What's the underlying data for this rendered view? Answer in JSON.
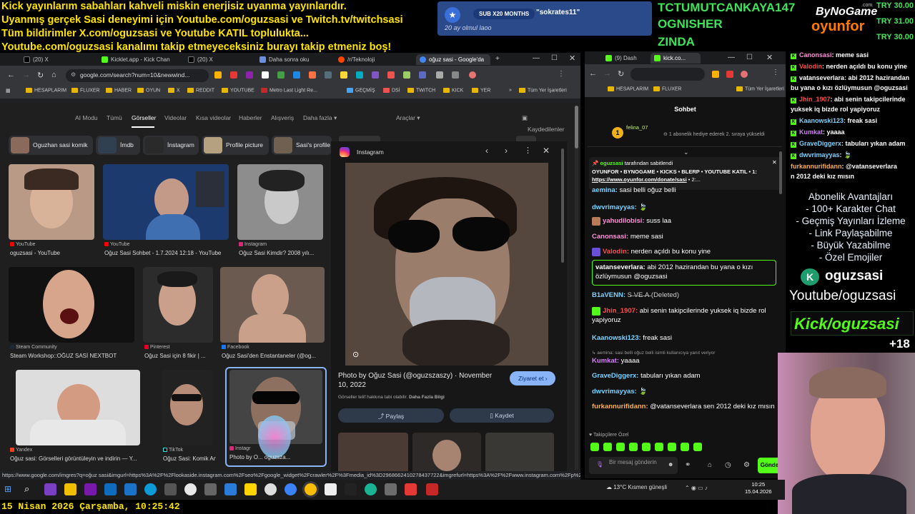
{
  "overlay": {
    "lines": [
      "Kick yayınlarım sabahları kahveli miskin enerjisiz uyanma yayınlarıdır.",
      "Uyanmış gerçek Sasi deneyimi için Youtube.com/oguzsasi ve Twitch.tv/twitchsasi",
      "Tüm bildirimler X.com/oguzsasi ve Youtube KATIL toplulukta...",
      "Youtube.com/oguzsasi kanalımı takip etmeyeceksiniz burayı takip etmeniz boş!"
    ],
    "sub_alert": {
      "pill": "SUB X20 MONTHS",
      "name": "\"sokrates11\"",
      "ago": "20 ay olmul laoo"
    },
    "goal_names": [
      "TCTUMUTCANKAYA147",
      "OGNISHER",
      "ZINDA"
    ],
    "brand_top": "ByNoGame",
    "brand_com": ".com",
    "brand_bottom": "oyunfor",
    "donations": [
      "TRY 30.00",
      "TRY 31.00",
      "TRY 30.00"
    ],
    "date_text": "15 Nisan 2026 Çarşamba, 10:25:42"
  },
  "browser_left": {
    "tabs": [
      "(20) X",
      "Kicklet.app - Kick Chan",
      "(20) X",
      "Daha sonra oku",
      "/r/Teknoloji",
      "oğuz sasi - Google'da"
    ],
    "url": "google.com/search?num=10&newwind...",
    "bookmarks": [
      "HESAPLARIM",
      "FLUXER",
      "HABER",
      "OYUN",
      "X",
      "REDDIT",
      "YOUTUBE",
      "Metro Last Light Re...",
      "GEÇMİŞ",
      "DSİ",
      "TWITCH",
      "KICK",
      "YER",
      "Tüm Yer İşaretleri"
    ],
    "search_tabs": [
      "AI Modu",
      "Tümü",
      "Görseller",
      "Videolar",
      "Kısa videolar",
      "Haberler",
      "Alışveriş",
      "Daha fazla ▾",
      "Araçlar ▾",
      "Kaydedilenler"
    ],
    "chips": [
      "Oguzhan sasi komik",
      "İmdb",
      "İnstagram",
      "Profile picture",
      "Sasi's profile"
    ],
    "results": [
      {
        "source": "YouTube",
        "caption": "oguzsasi - YouTube"
      },
      {
        "source": "YouTube",
        "caption": "Oğuz Sasi Sohbet - 1.7.2024 12:18 - YouTube"
      },
      {
        "source": "Instagram",
        "caption": "Oğuz Sasi Kimdir? 2008 yılı..."
      },
      {
        "source": "Steam Community",
        "caption": "Steam Workshop::OĞUZ SASİ NEXTBOT"
      },
      {
        "source": "Pinterest",
        "caption": "Oğuz Sasi için 8 fikir | ..."
      },
      {
        "source": "Facebook",
        "caption": "Oğuz Sasi'den Enstantaneler (@og..."
      },
      {
        "source": "Yandex",
        "caption": "Oğuz sasi: Görselleri görüntüleyin ve indirin — Y..."
      },
      {
        "source": "TikTok",
        "caption": "Oğuz Sasi: Komik An..."
      },
      {
        "source": "Instagr",
        "caption": "Photo by O... oguzsza..."
      }
    ],
    "panel": {
      "site": "Instagram",
      "title": "Photo by Oğuz Sasi (@oguzszaszy) · November 10, 2022",
      "note": "Görseller telif hakkına tabi olabilir.",
      "note_link": "Daha Fazla Bilgi",
      "visit": "Ziyaret et",
      "share": "Paylaş",
      "save": "Kaydet"
    },
    "status_url": "https://www.google.com/imgres?q=oğuz sasi&imgurl=https%3A%2F%2Flookaside.instagram.com%2Fseo%2Fgoogle_widget%2Fcrawler%2F%3Fmedia_id%3D2968662410278437722&imgrefurl=https%3A%2F%2Fwww.instagram.com%2Fp%2FCkyzrvGs4Na%..."
  },
  "browser_right": {
    "tabs": [
      "(9) Dash",
      "kick.co..."
    ],
    "bookmarks": [
      "HESAPLARIM",
      "FLUXER",
      "Tüm Yer İşaretleri"
    ],
    "chat_title": "Sohbet",
    "gifter": {
      "rank": "1",
      "name": "felina_07",
      "text": "1 abonelik hediye ederek 2. sıraya yükseldi"
    },
    "pinned_by": "oguzsasi",
    "pinned_label": "tarafından sabitlendi",
    "pinned_text": "OYUNFOR • BYNOGAME • KICKS • BLERP • YOUTUBE KATIL • 1:",
    "pinned_link": "https://www.oyunfor.com/donate/sasi",
    "pinned_tail": "• 2:...",
    "messages": [
      {
        "user": "aemina:",
        "text": "sasi belli oğuz belli",
        "color": "#7bd3ff"
      },
      {
        "user": "dwvrimayyas:",
        "text": "",
        "color": "#7bd3ff"
      },
      {
        "user": "yahudilobisi:",
        "text": "suss laa",
        "color": "#ff8fd8"
      },
      {
        "user": "Canonsasi:",
        "text": "meme sasi",
        "color": "#ff8fd8"
      },
      {
        "user": "Valodin:",
        "text": "nerden açıldı bu konu yine",
        "color": "#ff4d4d"
      },
      {
        "user": "vatanseverlara:",
        "text": "abi 2012 hazirandan bu yana o kızı özlüymusun @oguzsasi",
        "color": "#ffffff"
      },
      {
        "user": "B1aVENN:",
        "text": "S̶ ̶V̶E̶ ̶A̶ (Deleted)",
        "color": "#7bd3ff"
      },
      {
        "user": "Jhin_1907:",
        "text": "abi senin takipcilerinde yuksek iq bizde rol yapiyoruz",
        "color": "#ff4d4d"
      },
      {
        "user": "Kaanowski123:",
        "text": "freak sasi",
        "color": "#7bd3ff"
      },
      {
        "user": "aemina: sasi belli oğuz belli isimli kullanıcıya yanıt veriyor",
        "text": "",
        "color": "#9a9a9a"
      },
      {
        "user": "Kumkat:",
        "text": "yaaaa",
        "color": "#d67cff"
      },
      {
        "user": "GraveDiggerx:",
        "text": "tabuları yıkan adam",
        "color": "#7bd3ff"
      },
      {
        "user": "dwvrimayyas:",
        "text": "",
        "color": "#7bd3ff"
      },
      {
        "user": "furkannurifidann:",
        "text": "@vatanseverlara sen 2012 deki kız mısın",
        "color": "#ffb04d"
      }
    ],
    "follower_label": "Takipçilere Özel",
    "input_placeholder": "Bir mesaj gönderin",
    "send": "Gönder",
    "weather": "13°C  Kısmen güneşli",
    "clock": "10:25",
    "date": "15.04.2026"
  },
  "right_log": [
    {
      "user": "Canonsasi",
      "text": ": meme sasi",
      "color": "#ff8fd8"
    },
    {
      "user": "Valodin",
      "text": ": nerden açıldı bu konu yine",
      "color": "#ff4d4d"
    },
    {
      "user": "vatanseverlara",
      "text": ": abi 2012 hazirandan",
      "color": "#ffffff"
    },
    {
      "user": "",
      "text": "bu yana o kızı özlüymusun @oguzsasi",
      "color": "#ffffff"
    },
    {
      "user": "Jhin_1907",
      "text": ": abi senin takipcilerinde",
      "color": "#ff4d4d"
    },
    {
      "user": "",
      "text": "yuksek iq bizde rol yapiyoruz",
      "color": "#ffffff"
    },
    {
      "user": "Kaanowski123",
      "text": ": freak sasi",
      "color": "#7bd3ff"
    },
    {
      "user": "Kumkat",
      "text": ": yaaaa",
      "color": "#d67cff"
    },
    {
      "user": "GraveDiggerx",
      "text": ": tabuları yıkan adam",
      "color": "#7bd3ff"
    },
    {
      "user": "dwvrimayyas",
      "text": ": 🍃",
      "color": "#7bd3ff"
    },
    {
      "user": "furkannurifidann",
      "text": ": @vatanseverlara",
      "color": "#ffb04d"
    },
    {
      "user": "",
      "text": "n 2012 deki kız mısın",
      "color": "#ffffff"
    }
  ],
  "perks": {
    "title": "Abonelik Avantajları",
    "items": [
      "- 100+ Karakter Chat",
      "- Geçmiş Yayınları İzleme",
      "- Link Paylaşabilme",
      "- Büyük Yazabilme",
      "- Özel Emojiler"
    ]
  },
  "socials": {
    "kick_name": "oguzsasi",
    "youtube": "Youtube/oguzsasi",
    "kick_url": "Kick/oguzsasi",
    "age": "+18"
  },
  "colors": {
    "overlay_yellow": "#ffe400",
    "kick_green": "#53fc18",
    "goal_green": "#3fe35b"
  }
}
